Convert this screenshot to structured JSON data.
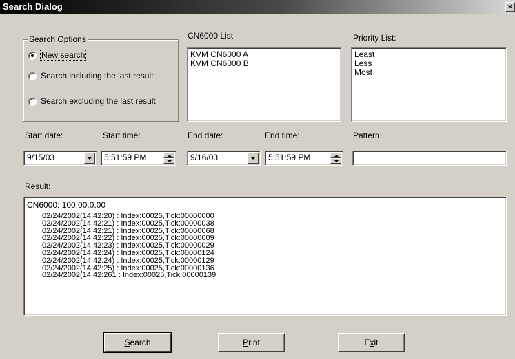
{
  "window": {
    "title": "Search Dialog",
    "close_glyph": "×"
  },
  "search_options": {
    "legend": "Search Options",
    "options": [
      {
        "label": "New search",
        "checked": true
      },
      {
        "label": "Search including the last result",
        "checked": false
      },
      {
        "label": "Search excluding the last result",
        "checked": false
      }
    ]
  },
  "cn6000_list": {
    "label": "CN6000 List",
    "items": [
      "KVM CN6000 A",
      "KVM CN6000 B"
    ]
  },
  "priority_list": {
    "label": "Priority List:",
    "items": [
      "Least",
      "Less",
      "Most"
    ]
  },
  "filters": {
    "start_date": {
      "label": "Start date:",
      "value": "9/15/03"
    },
    "start_time": {
      "label": "Start time:",
      "value": "5:51:59 PM"
    },
    "end_date": {
      "label": "End date:",
      "value": "9/16/03"
    },
    "end_time": {
      "label": "End time:",
      "value": "5:51:59 PM"
    },
    "pattern": {
      "label": "Pattern:",
      "value": ""
    }
  },
  "result": {
    "label": "Result:",
    "header": "CN6000: 100.00.0.00",
    "lines": [
      "02/24/2002(14:42:20) : Index:00025,Tick:00000000",
      "02/24/2002(14:42:21) : Index:00025,Tick:00000038",
      "02/24/2002(14:42:21) : Index:00025,Tick:00000068",
      "02/24/2002(14:42:22) : Index:00025,Tick:00000009",
      "02/24/2002(14:42:23) : Index:00025,Tick:00000029",
      "02/24/2002(14:42:24) : Index:00025,Tick:00000124",
      "02/24/2002(14:42:24) : Index:00025,Tick:00000129",
      "02/24/2002(14:42:25) : Index:00025,Tick:00000136",
      "02/24/2002(14:42:261 : Index:00025,Tick:00000139"
    ]
  },
  "buttons": {
    "search": {
      "mnemonic": "S",
      "rest": "earch"
    },
    "print": {
      "mnemonic": "P",
      "rest": "rint"
    },
    "exit": {
      "pre": "E",
      "mnemonic": "x",
      "rest": "it"
    }
  },
  "icons": {
    "combo_arrow": "chevron-down-icon",
    "spin_up": "chevron-up-icon",
    "spin_down": "chevron-down-icon",
    "radio_selected": "radio-selected-icon",
    "radio_unselected": "radio-unselected-icon"
  },
  "colors": {
    "dialog_bg": "#d4d0c8",
    "titlebar_start": "#000000",
    "titlebar_end": "#d8d8d8",
    "field_bg": "#ffffff"
  }
}
